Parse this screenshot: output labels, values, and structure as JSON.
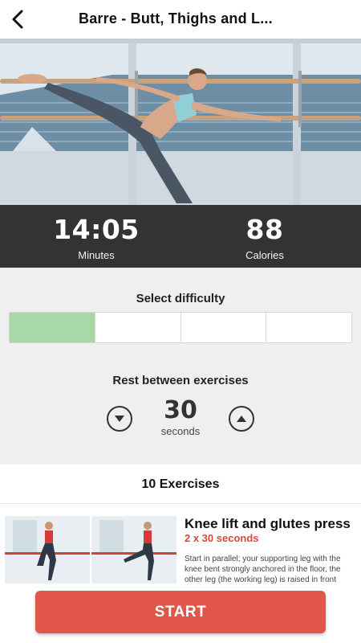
{
  "header": {
    "title": "Barre - Butt, Thighs and L...",
    "back_icon": "chevron-left-icon"
  },
  "stats": {
    "minutes_value": "14:05",
    "minutes_label": "Minutes",
    "calories_value": "88",
    "calories_label": "Calories"
  },
  "difficulty": {
    "title": "Select difficulty",
    "levels": 4,
    "selected_index": 0,
    "active_color": "#a8d8a8"
  },
  "rest": {
    "title": "Rest between exercises",
    "value": "30",
    "unit": "seconds",
    "decrease_icon": "triangle-down-icon",
    "increase_icon": "triangle-up-icon"
  },
  "exercises": {
    "count_label": "10 Exercises",
    "items": [
      {
        "name": "Knee lift and glutes press",
        "reps": "2 x 30 seconds",
        "description": "Start in parallel; your supporting leg with the knee bent strongly anchored in the floor, the other leg (the working leg) is raised in front"
      }
    ]
  },
  "start_button": {
    "label": "START",
    "color": "#e0564a"
  }
}
